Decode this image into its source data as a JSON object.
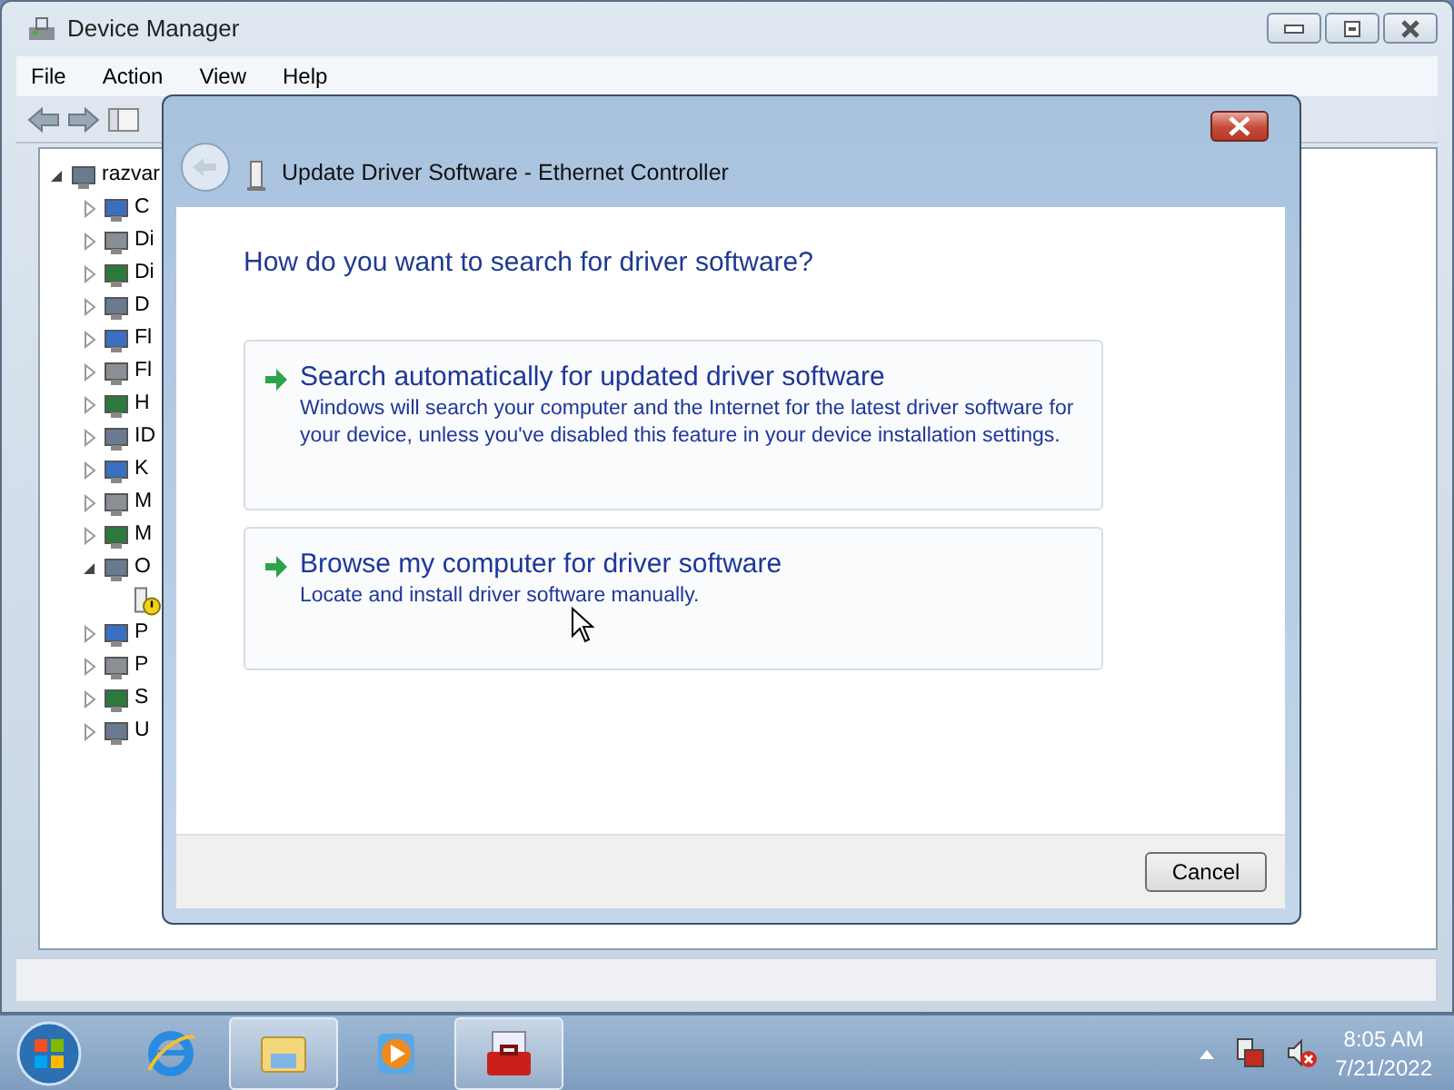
{
  "main_window": {
    "title": "Device Manager",
    "menu": [
      "File",
      "Action",
      "View",
      "Help"
    ],
    "tree": {
      "label": "razvar",
      "expanded": true,
      "children": [
        {
          "label": "C",
          "expanded": false
        },
        {
          "label": "Di",
          "expanded": false
        },
        {
          "label": "Di",
          "expanded": false
        },
        {
          "label": "D",
          "expanded": false
        },
        {
          "label": "Fl",
          "expanded": false
        },
        {
          "label": "Fl",
          "expanded": false
        },
        {
          "label": "H",
          "expanded": false
        },
        {
          "label": "ID",
          "expanded": false
        },
        {
          "label": "K",
          "expanded": false
        },
        {
          "label": "M",
          "expanded": false
        },
        {
          "label": "M",
          "expanded": false
        },
        {
          "label": "O",
          "expanded": true,
          "children": [
            {
              "warning": true
            }
          ]
        },
        {
          "label": "P",
          "expanded": false
        },
        {
          "label": "P",
          "expanded": false
        },
        {
          "label": "S",
          "expanded": false
        },
        {
          "label": "U",
          "expanded": false
        }
      ]
    }
  },
  "dialog": {
    "title": "Update Driver Software - Ethernet Controller",
    "heading": "How do you want to search for driver software?",
    "options": [
      {
        "title": "Search automatically for updated driver software",
        "description": "Windows will search your computer and the Internet for the latest driver software for your device, unless you've disabled this feature in your device installation settings."
      },
      {
        "title": "Browse my computer for driver software",
        "description": "Locate and install driver software manually."
      }
    ],
    "buttons": [
      "Cancel"
    ]
  },
  "taskbar": {
    "items": [
      {
        "kind": "ie",
        "running": false
      },
      {
        "kind": "explorer",
        "running": true
      },
      {
        "kind": "media",
        "running": false
      },
      {
        "kind": "toolbox",
        "running": true
      }
    ],
    "time": "8:05 AM",
    "date": "7/21/2022"
  }
}
